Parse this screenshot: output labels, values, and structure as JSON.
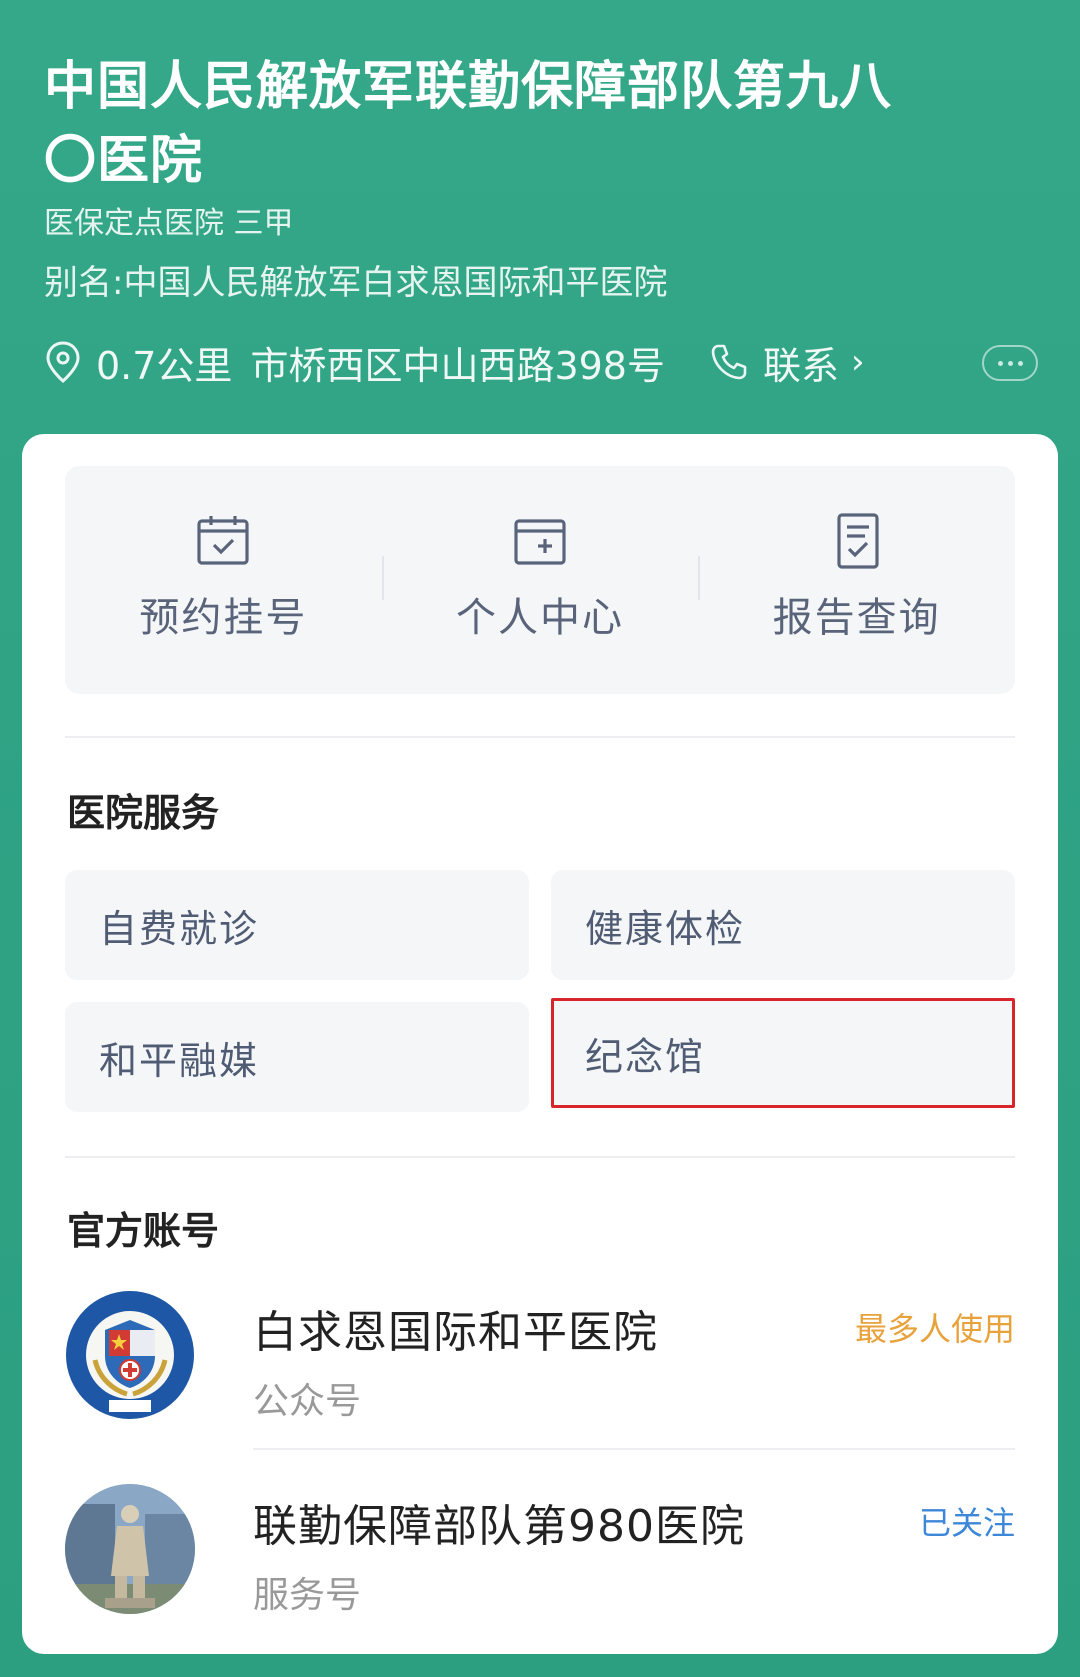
{
  "header": {
    "hospital_name": "中国人民解放军联勤保障部队第九八〇医院",
    "tags": "医保定点医院 三甲",
    "alias": "别名:中国人民解放军白求恩国际和平医院",
    "distance": "0.7公里",
    "address": "市桥西区中山西路398号",
    "contact_label": "联系",
    "pin_icon": "location-pin-icon",
    "phone_icon": "phone-icon"
  },
  "quick_actions": [
    {
      "label": "预约挂号",
      "icon": "calendar-check-icon"
    },
    {
      "label": "个人中心",
      "icon": "folder-plus-icon"
    },
    {
      "label": "报告查询",
      "icon": "report-document-icon"
    }
  ],
  "services": {
    "title": "医院服务",
    "items": [
      {
        "label": "自费就诊"
      },
      {
        "label": "健康体检"
      },
      {
        "label": "和平融媒"
      },
      {
        "label": "纪念馆",
        "highlighted": true
      }
    ]
  },
  "accounts": {
    "title": "官方账号",
    "items": [
      {
        "name": "白求恩国际和平医院",
        "kind": "公众号",
        "badge": "最多人使用",
        "badge_color": "#e8a23b"
      },
      {
        "name": "联勤保障部队第980医院",
        "kind": "服务号",
        "badge": "已关注",
        "badge_color": "#3d87d9"
      }
    ]
  },
  "colors": {
    "header_green": "#2fa384",
    "highlight_red": "#d7262b",
    "label_gray_blue": "#505c73"
  }
}
